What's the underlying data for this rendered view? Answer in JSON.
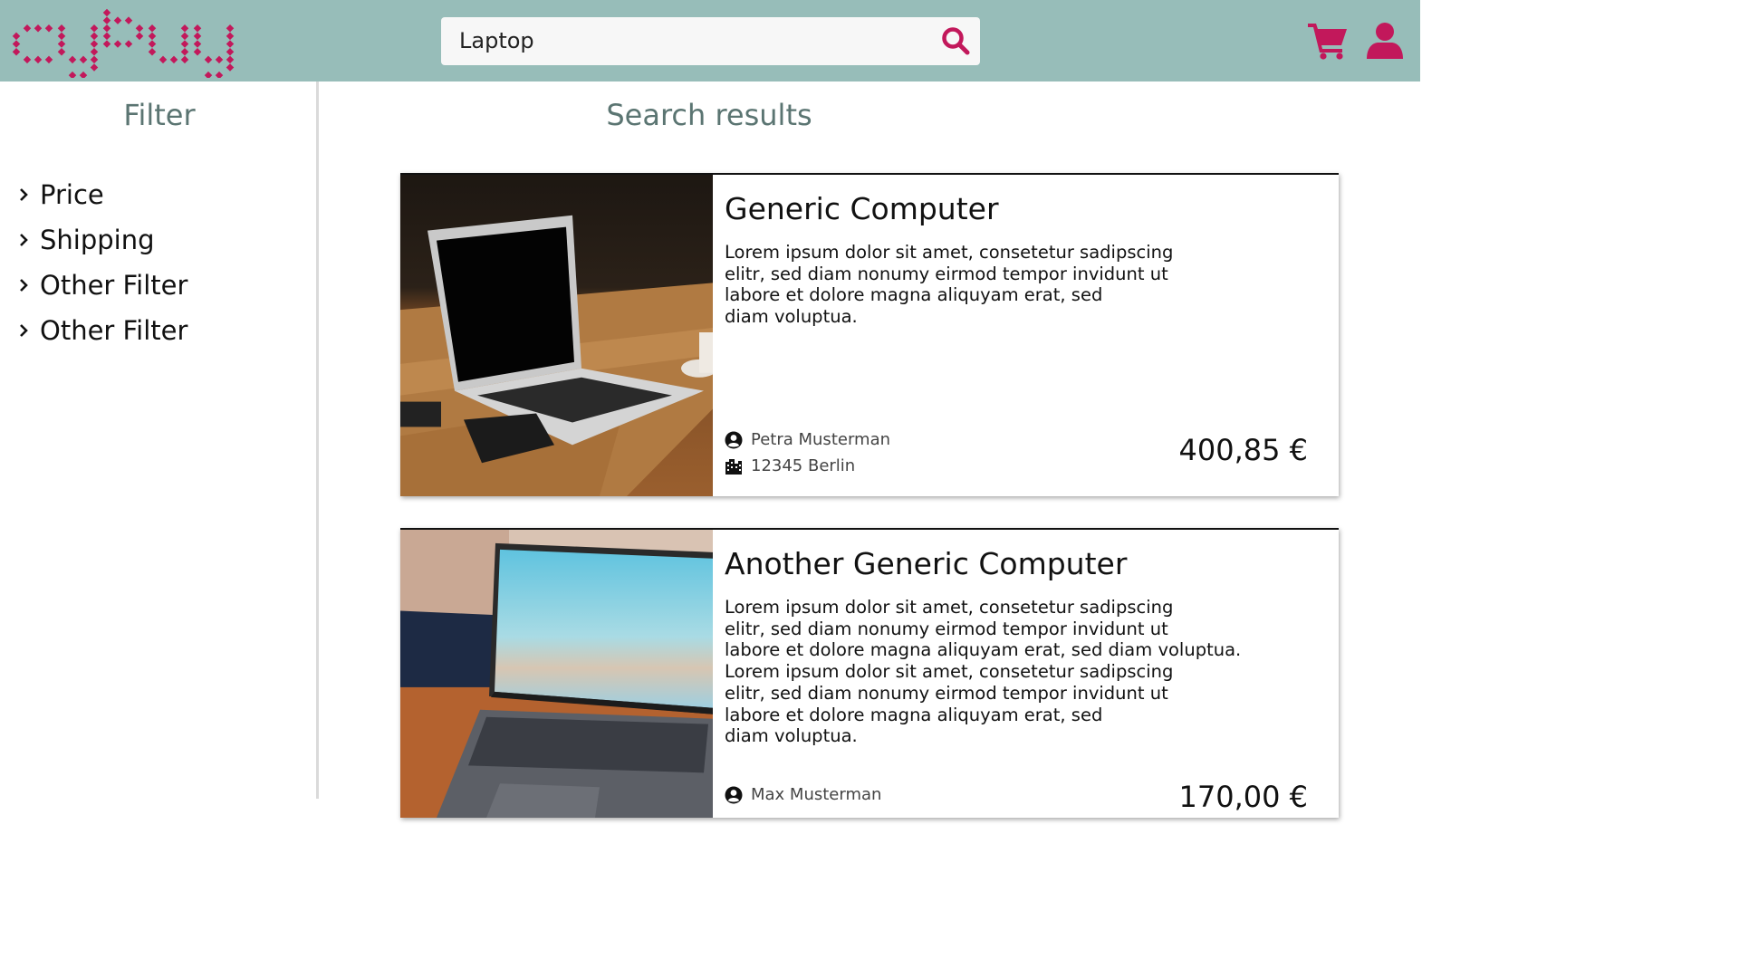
{
  "header": {
    "logo_text": "cybuy",
    "search_value": "Laptop",
    "brand_color": "#c2185b",
    "background_color": "#97bdb9",
    "icons": [
      "search-icon",
      "cart-icon",
      "user-icon"
    ]
  },
  "sidebar": {
    "title": "Filter",
    "items": [
      {
        "label": "Price"
      },
      {
        "label": "Shipping"
      },
      {
        "label": "Other Filter"
      },
      {
        "label": "Other Filter"
      }
    ]
  },
  "main": {
    "title": "Search results",
    "results": [
      {
        "title": "Generic Computer",
        "description_lines": [
          "Lorem ipsum dolor sit amet, consetetur sadipscing",
          "elitr, sed diam nonumy eirmod tempor invidunt ut",
          "labore et dolore magna aliquyam erat, sed",
          "diam voluptua."
        ],
        "seller": "Petra Musterman",
        "location": "12345 Berlin",
        "price": "400,85 €"
      },
      {
        "title": "Another Generic Computer",
        "description_lines": [
          "Lorem ipsum dolor sit amet, consetetur sadipscing",
          "elitr, sed diam nonumy eirmod tempor invidunt ut",
          "labore et dolore magna aliquyam erat, sed diam voluptua.",
          "Lorem ipsum dolor sit amet, consetetur sadipscing",
          "elitr, sed diam nonumy eirmod tempor invidunt ut",
          "labore et dolore magna aliquyam erat, sed",
          "diam voluptua."
        ],
        "seller": "Max Musterman",
        "price": "170,00 €"
      }
    ]
  }
}
